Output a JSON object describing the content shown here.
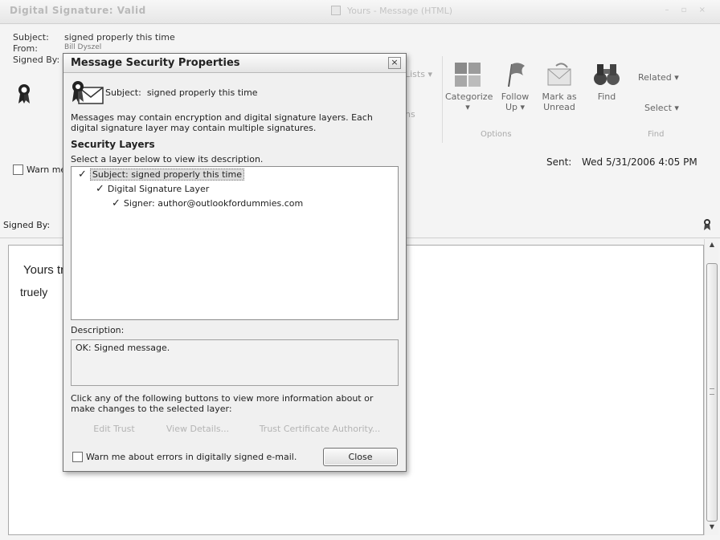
{
  "window": {
    "title": "Digital Signature: Valid",
    "app_title": "Yours - Message (HTML)",
    "controls": "– ▫ ×"
  },
  "header": {
    "subject_label": "Subject:",
    "subject_value": "signed properly this time",
    "from_label": "From:",
    "from_value": "Bill Dyszel",
    "signed_by_label": "Signed By:",
    "warn_label": "Warn me",
    "sent_label": "Sent:",
    "sent_value": "Wed 5/31/2006 4:05 PM",
    "signed_by_label2": "Signed By:"
  },
  "ribbon": {
    "lists": "Lists ▾",
    "lists2": "ns",
    "categorize": "Categorize",
    "categorize_arrow": "▾",
    "follow_up": "Follow",
    "follow_up2": "Up ▾",
    "mark_as": "Mark as",
    "unread": "Unread",
    "find": "Find",
    "related": "Related ▾",
    "select": "Select ▾",
    "group_options": "Options",
    "group_find": "Find"
  },
  "body": {
    "line1": "Yours tr",
    "line2": "truely"
  },
  "dialog": {
    "title": "Message Security Properties",
    "close_glyph": "×",
    "subject_label": "Subject:",
    "subject_value": "signed properly this time",
    "info": "Messages may contain encryption and digital signature layers. Each digital signature layer may contain multiple signatures.",
    "layers_header": "Security Layers",
    "layers_hint": "Select a layer below to view its description.",
    "layers": [
      "Subject: signed properly this time",
      "Digital Signature Layer",
      "Signer: author@outlookfordummies.com"
    ],
    "description_label": "Description:",
    "description": "OK: Signed message.",
    "click_info": "Click any of the following buttons to view more information about or make changes to the selected layer:",
    "btn_edit_trust": "Edit Trust",
    "btn_view_details": "View Details...",
    "btn_trust_ca": "Trust Certificate Authority...",
    "warn_label": "Warn me about errors in digitally signed e-mail.",
    "close_label": "Close"
  }
}
